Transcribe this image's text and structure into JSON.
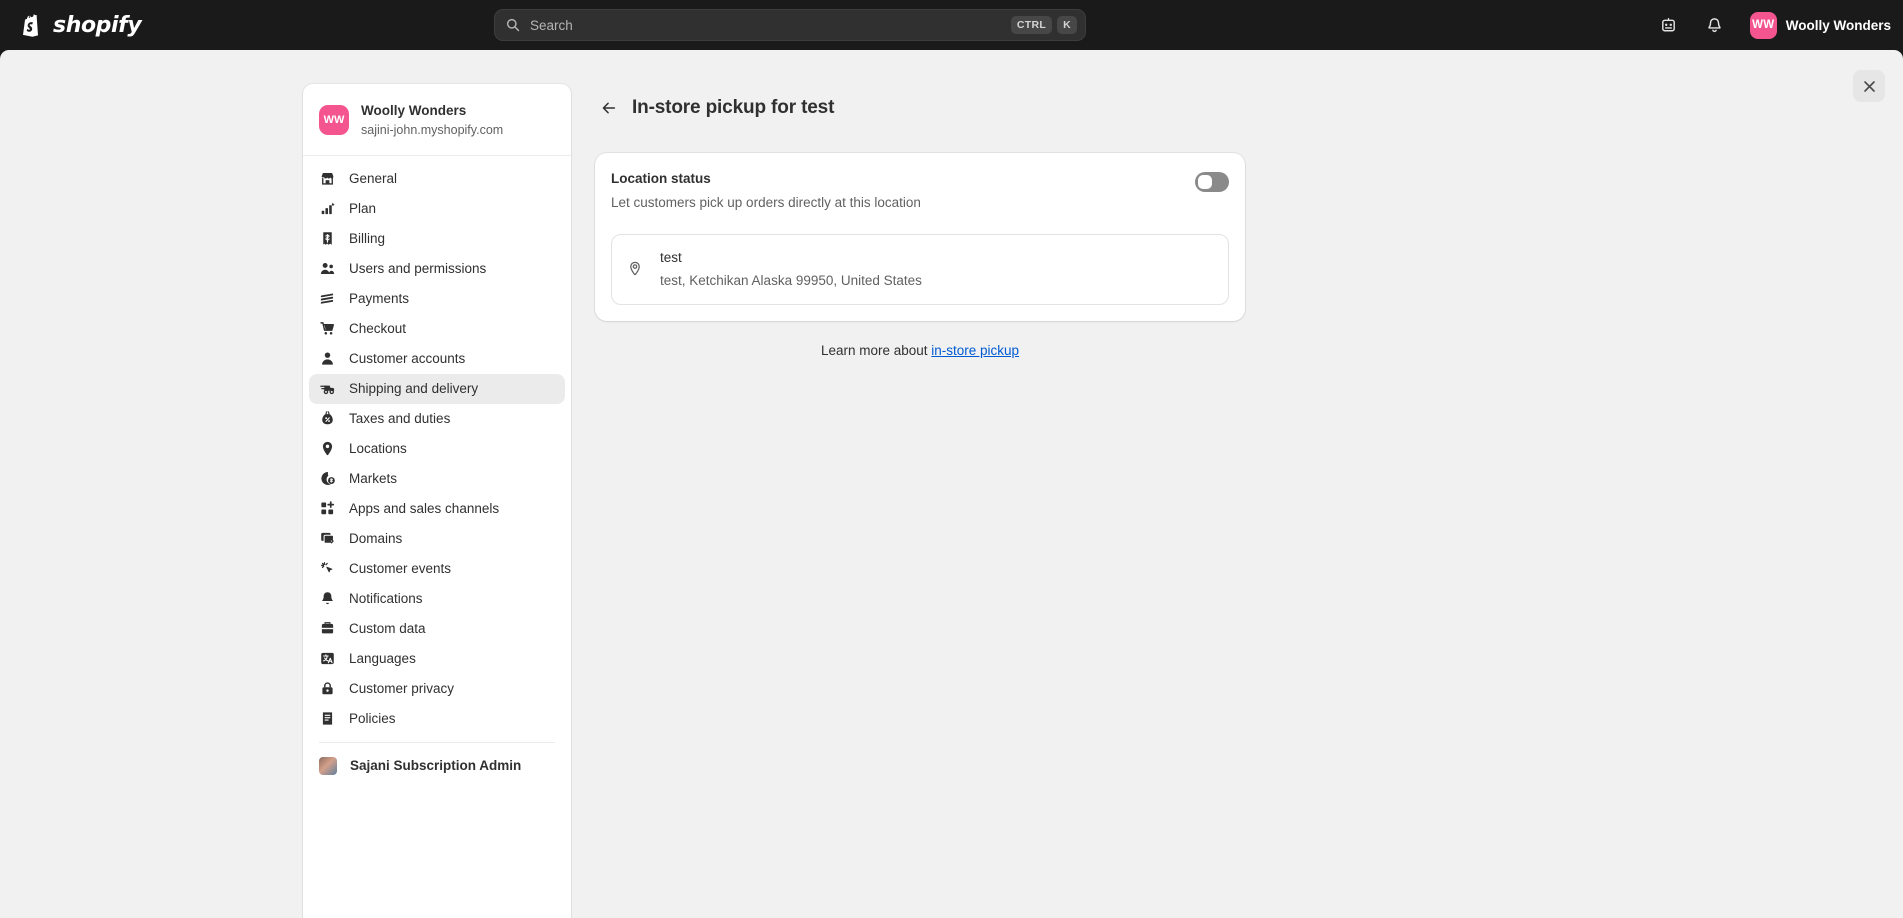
{
  "topbar": {
    "logo_text": "shopify",
    "logo_icon": "shopify-bag-icon",
    "search": {
      "icon": "search-icon",
      "placeholder": "Search",
      "key_ctrl": "CTRL",
      "key_k": "K"
    },
    "sidekick_icon": "sidekick-robot-icon",
    "notifications_icon": "bell-icon",
    "user": {
      "initials": "WW",
      "name": "Woolly Wonders",
      "avatar_color": "#f4558f"
    }
  },
  "modal": {
    "close_icon": "close-icon"
  },
  "sidebar": {
    "store": {
      "initials": "WW",
      "name": "Woolly Wonders",
      "domain": "sajini-john.myshopify.com"
    },
    "items": [
      {
        "label": "General",
        "icon": "store-icon",
        "selected": false
      },
      {
        "label": "Plan",
        "icon": "chart-bar-icon",
        "selected": false
      },
      {
        "label": "Billing",
        "icon": "receipt-dollar-icon",
        "selected": false
      },
      {
        "label": "Users and permissions",
        "icon": "people-icon",
        "selected": false
      },
      {
        "label": "Payments",
        "icon": "payment-card-icon",
        "selected": false
      },
      {
        "label": "Checkout",
        "icon": "shopping-cart-icon",
        "selected": false
      },
      {
        "label": "Customer accounts",
        "icon": "person-icon",
        "selected": false
      },
      {
        "label": "Shipping and delivery",
        "icon": "delivery-truck-icon",
        "selected": true
      },
      {
        "label": "Taxes and duties",
        "icon": "tax-bag-icon",
        "selected": false
      },
      {
        "label": "Locations",
        "icon": "location-pin-icon",
        "selected": false
      },
      {
        "label": "Markets",
        "icon": "globe-dollar-icon",
        "selected": false
      },
      {
        "label": "Apps and sales channels",
        "icon": "apps-grid-plus-icon",
        "selected": false
      },
      {
        "label": "Domains",
        "icon": "domains-window-icon",
        "selected": false
      },
      {
        "label": "Customer events",
        "icon": "cursor-click-icon",
        "selected": false
      },
      {
        "label": "Notifications",
        "icon": "bell-icon",
        "selected": false
      },
      {
        "label": "Custom data",
        "icon": "database-icon",
        "selected": false
      },
      {
        "label": "Languages",
        "icon": "languages-icon",
        "selected": false
      },
      {
        "label": "Customer privacy",
        "icon": "lock-privacy-icon",
        "selected": false
      },
      {
        "label": "Policies",
        "icon": "policies-document-icon",
        "selected": false
      }
    ],
    "app_item": {
      "label": "Sajani Subscription Admin",
      "icon": "app-thumbnail-icon"
    }
  },
  "main": {
    "back_icon": "arrow-left-icon",
    "title": "In-store pickup for test",
    "status_card": {
      "title": "Location status",
      "subtitle": "Let customers pick up orders directly at this location",
      "toggle": {
        "state": "off",
        "name": "location-status-toggle"
      },
      "location": {
        "icon": "location-pin-icon",
        "name": "test",
        "address": "test, Ketchikan Alaska 99950, United States"
      }
    },
    "footer": {
      "learn_prefix": "Learn more about ",
      "learn_link": "in-store pickup",
      "link_color": "#005bd3"
    }
  }
}
